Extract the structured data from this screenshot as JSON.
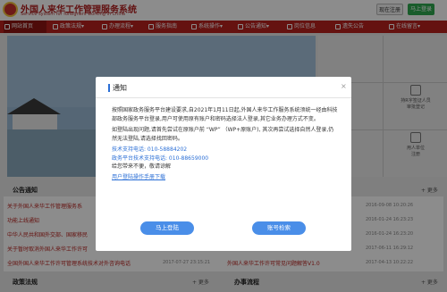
{
  "header": {
    "title": "外国人来华工作管理服务系统",
    "subtitle": "Service system for foreigners working in China",
    "register_label": "现在注册",
    "login_label": "马上登录"
  },
  "nav": {
    "items": [
      {
        "label": "网站首页",
        "icon": "home-icon"
      },
      {
        "label": "政策法规",
        "icon": "document-icon"
      },
      {
        "label": "办理流程",
        "icon": "flow-icon"
      },
      {
        "label": "服务指南",
        "icon": "guide-icon"
      },
      {
        "label": "系统操作",
        "icon": "gear-icon"
      },
      {
        "label": "公告通知",
        "icon": "bell-icon"
      },
      {
        "label": "岗位信息",
        "icon": "briefcase-icon"
      },
      {
        "label": "遗失公告",
        "icon": "alert-icon"
      },
      {
        "label": "在线留言",
        "icon": "chat-icon"
      }
    ]
  },
  "side": {
    "items": [
      {
        "label": "持R字签证人员",
        "label2": "审批登记"
      },
      {
        "label": "用人单位",
        "label2": "注册"
      }
    ]
  },
  "notice_section": {
    "title": "公告通知",
    "more": "+ 更多",
    "rows": [
      {
        "title": "关于外国人来华工作管理服务系",
        "date": "2017-07-28"
      },
      {
        "title": "功能上线通知",
        "date": ""
      },
      {
        "title": "中华人民共和国外交部、国家移民",
        "date": ""
      },
      {
        "title": "关于暂时取消外国人来华工作许可",
        "date": ""
      },
      {
        "title": "全国外国人来华工作许可管理系统技术对外咨询电话",
        "date": "2017-07-27 23:15:21"
      }
    ],
    "right_rows": [
      {
        "title": "",
        "date": "2016-09-08 10:20:26"
      },
      {
        "title": "",
        "date": "2016-01-24 16:23:23"
      },
      {
        "title": "外国人才签…",
        "date": "2016-01-24 16:23:20"
      },
      {
        "title": "",
        "date": "2017-06-11 16:29:12"
      },
      {
        "title": "外国人来华工作许可常见问题解答V1.0",
        "date": "2017-04-13 10:22:22"
      }
    ]
  },
  "policy_section": {
    "title": "政策法规",
    "more": "+ 更多"
  },
  "process_section": {
    "title": "办事流程",
    "more": "+ 更多"
  },
  "modal": {
    "title": "通知",
    "close": "×",
    "para1": "按照国家政务服务平台建设要求,自2021年1月11日起,外国人来华工作服务系统须统一经由科技部政务服务平台登录,用户可使用原有账户和密码选择法人登录,其它业务办理方式不变。",
    "para2": "如登陆出现问题,请首先尝试在原账户前 “WP” （WP+原账户), 其次再尝试选择自然人登录,仍然无法登陆,请选择找回密码。",
    "phone1": "技术支持电话: 010-58884202",
    "phone2": "政务平台技术支持电话: 010-88659000",
    "apology": "给您带来不便，敬请谅解",
    "manual_link": "用户登陆操作手册下载",
    "login_button": "马上登陆",
    "recover_button": "账号检索"
  }
}
